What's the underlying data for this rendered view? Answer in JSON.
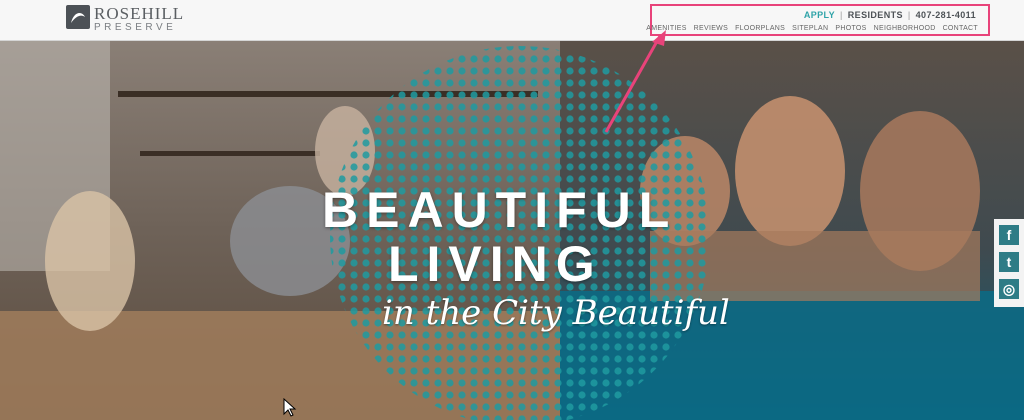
{
  "brand": {
    "name": "ROSEHILL",
    "sub": "PRESERVE"
  },
  "nav": {
    "apply": "APPLY",
    "residents": "RESIDENTS",
    "phone": "407-281-4011",
    "links": [
      "AMENITIES",
      "REVIEWS",
      "FLOORPLANS",
      "SITEPLAN",
      "PHOTOS",
      "NEIGHBORHOOD",
      "CONTACT"
    ]
  },
  "hero": {
    "line1": "BEAUTIFUL",
    "line2": "LIVING",
    "script": "in the City Beautiful"
  },
  "social": {
    "facebook": "f",
    "twitter": "t",
    "instagram": "◎"
  },
  "colors": {
    "accent": "#2fa3a8",
    "annotation": "#e8437a",
    "dots": "#1f9aa0"
  }
}
